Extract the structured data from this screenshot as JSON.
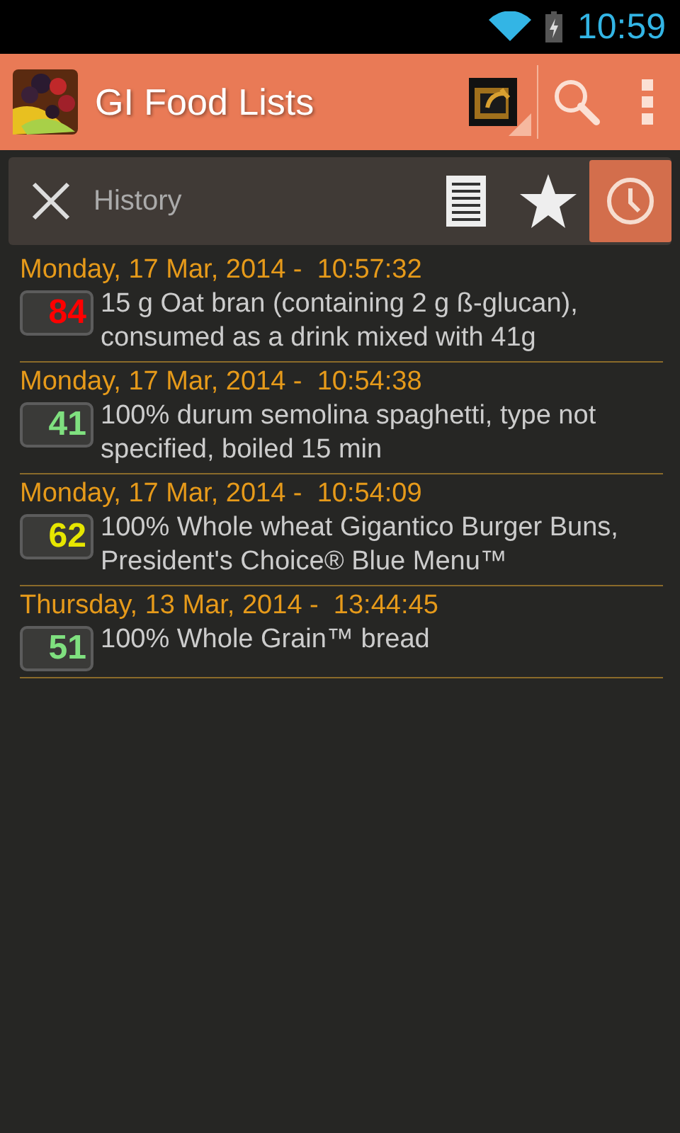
{
  "status_bar": {
    "time": "10:59"
  },
  "app_bar": {
    "title": "GI Food Lists"
  },
  "tab_bar": {
    "title": "History",
    "tabs": [
      {
        "kind": "list",
        "selected": false
      },
      {
        "kind": "favorites",
        "selected": false
      },
      {
        "kind": "history",
        "selected": true
      }
    ]
  },
  "entries": [
    {
      "timestamp": "Monday, 17 Mar, 2014 -  10:57:32",
      "gi": "84",
      "color": "#ff0000",
      "food": "15 g Oat bran (containing 2 g ß-glucan), consumed as a drink mixed with 41g"
    },
    {
      "timestamp": "Monday, 17 Mar, 2014 -  10:54:38",
      "gi": "41",
      "color": "#7fe07f",
      "food": "100% durum semolina spaghetti, type not specified, boiled 15 min"
    },
    {
      "timestamp": "Monday, 17 Mar, 2014 -  10:54:09",
      "gi": "62",
      "color": "#e6e600",
      "food": "100% Whole wheat Gigantico Burger Buns, President's Choice® Blue Menu™"
    },
    {
      "timestamp": "Thursday, 13 Mar, 2014 -  13:44:45",
      "gi": "51",
      "color": "#7fe07f",
      "food": "100% Whole Grain™ bread"
    }
  ]
}
